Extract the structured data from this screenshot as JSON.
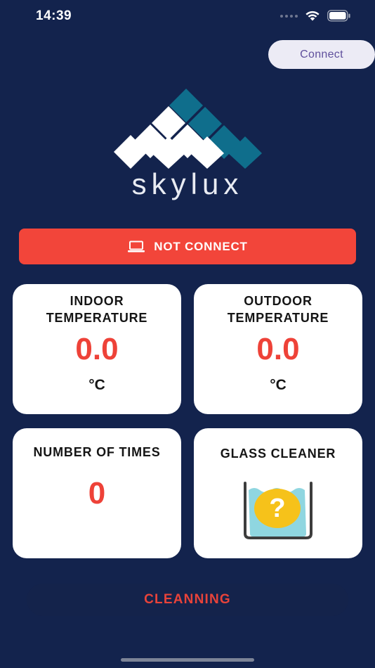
{
  "status_bar": {
    "time": "14:39"
  },
  "header": {
    "connect_label": "Connect"
  },
  "brand": {
    "name": "skylux"
  },
  "connection": {
    "status_label": "NOT CONNECT",
    "icon": "laptop-icon",
    "color": "#f2453a"
  },
  "cards": {
    "indoor": {
      "title_line1": "INDOOR",
      "title_line2": "TEMPERATURE",
      "value": "0.0",
      "unit": "°C"
    },
    "outdoor": {
      "title_line1": "OUTDOOR",
      "title_line2": "TEMPERATURE",
      "value": "0.0",
      "unit": "°C"
    },
    "times": {
      "title": "NUMBER OF TIMES",
      "value": "0"
    },
    "glass": {
      "title": "GLASS CLEANER",
      "status_symbol": "?",
      "icon": "water-tank-icon"
    }
  },
  "actions": {
    "clean_label": "CLEANNING"
  },
  "colors": {
    "background": "#13234d",
    "accent_red": "#ee4238",
    "logo_teal": "#0f6e8c",
    "water": "#8fd6e0",
    "badge_yellow": "#f6c21a"
  }
}
